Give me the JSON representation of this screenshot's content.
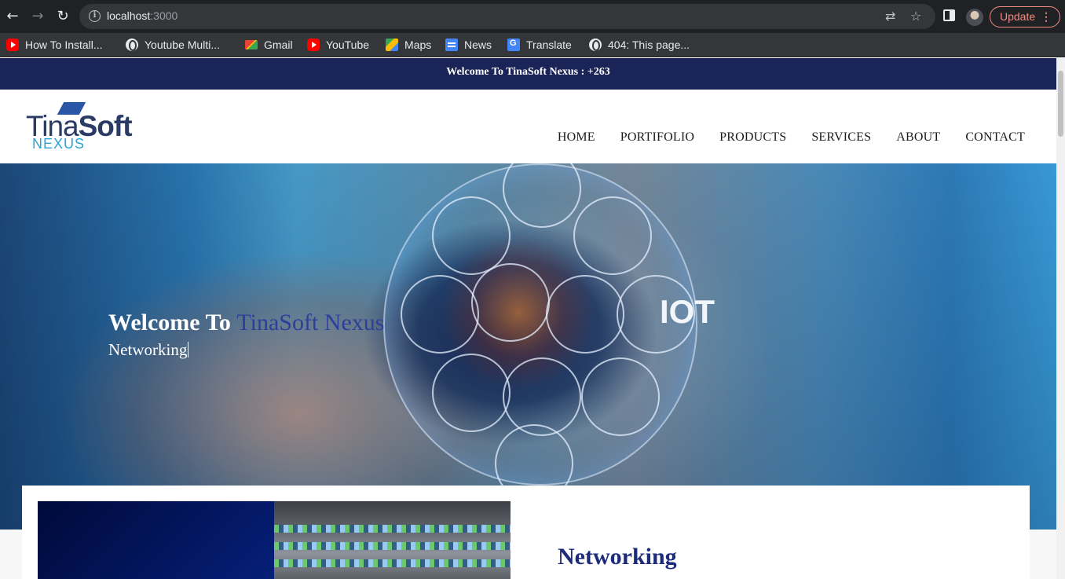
{
  "browser": {
    "url_host": "localhost",
    "url_port": ":3000",
    "update_label": "Update",
    "bookmarks": [
      {
        "label": "How To Install...",
        "icon": "youtube-icon"
      },
      {
        "label": "Youtube Multi...",
        "icon": "globe-icon"
      },
      {
        "label": "Gmail",
        "icon": "gmail-icon"
      },
      {
        "label": "YouTube",
        "icon": "youtube-icon"
      },
      {
        "label": "Maps",
        "icon": "maps-icon"
      },
      {
        "label": "News",
        "icon": "news-icon"
      },
      {
        "label": "Translate",
        "icon": "translate-icon"
      },
      {
        "label": "404: This page...",
        "icon": "globe-icon"
      }
    ]
  },
  "site": {
    "topbar_text": "Welcome To TinaSoft Nexus : +263",
    "logo": {
      "word_light": "Tina",
      "word_bold": "Soft",
      "sub": "NEXUS"
    },
    "menu": [
      "HOME",
      "PORTIFOLIO",
      "PRODUCTS",
      "SERVICES",
      "ABOUT",
      "CONTACT"
    ],
    "hero": {
      "title_prefix": "Welcome To ",
      "title_brand": "TinaSoft Nexus",
      "typed_text": "Networking",
      "image_text": "IOT"
    },
    "section": {
      "title": "Networking"
    },
    "colors": {
      "topbar": "#1a2456",
      "brand": "#2c3f9a",
      "section_title": "#1d2c7a"
    }
  }
}
